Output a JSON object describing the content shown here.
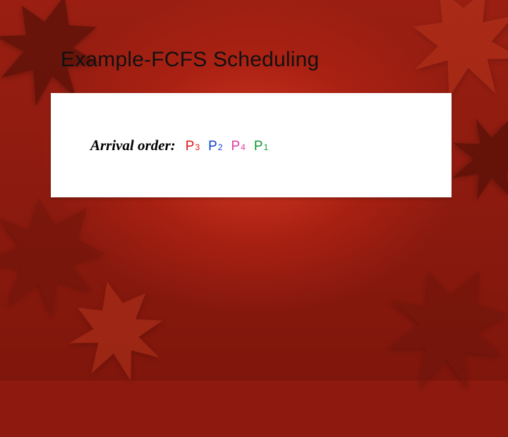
{
  "title": "Example-FCFS Scheduling",
  "arrival": {
    "label": "Arrival order:",
    "items": [
      {
        "name": "P",
        "sub": "3",
        "color": "red"
      },
      {
        "name": "P",
        "sub": "2",
        "color": "blue"
      },
      {
        "name": "P",
        "sub": "4",
        "color": "pink"
      },
      {
        "name": "P",
        "sub": "1",
        "color": "green"
      }
    ]
  }
}
